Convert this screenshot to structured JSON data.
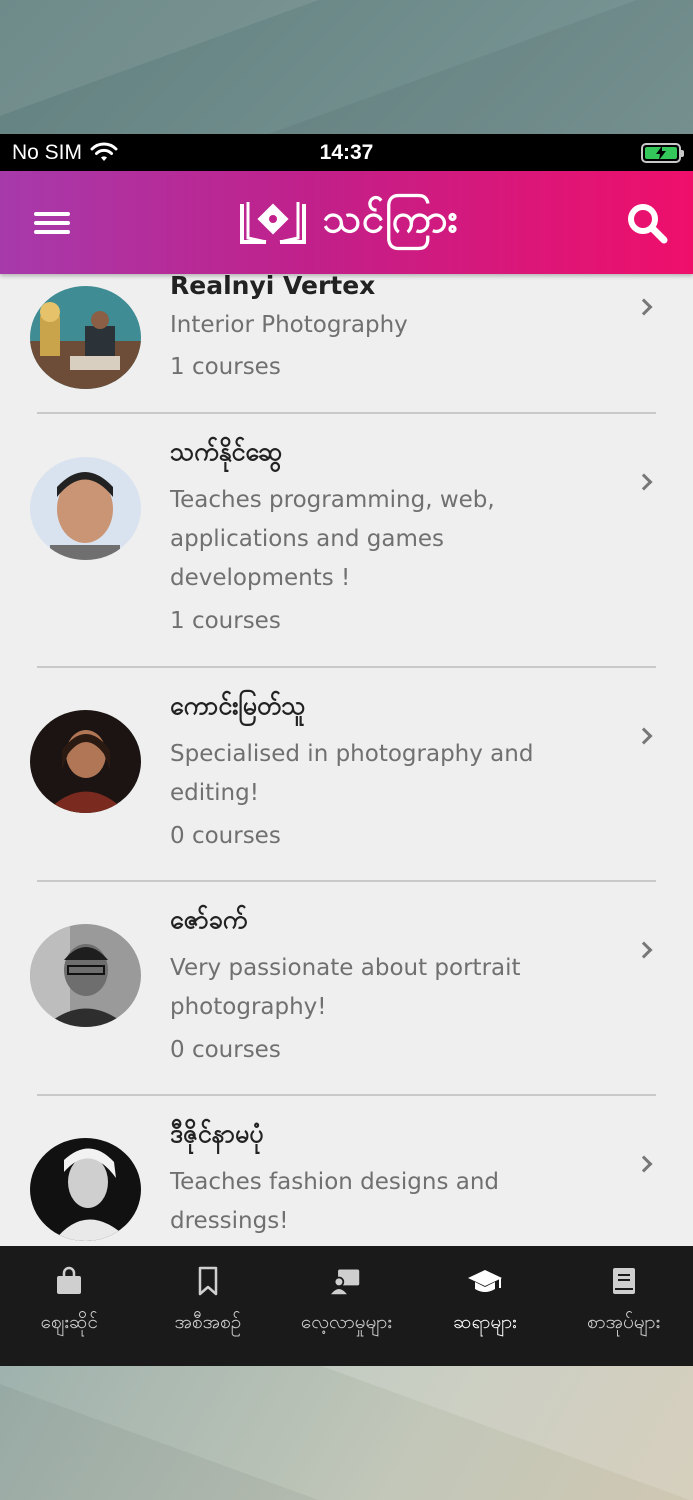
{
  "status": {
    "carrier": "No SIM",
    "time": "14:37"
  },
  "header": {
    "app_name": "သင်ကြား"
  },
  "teachers": [
    {
      "name": "Realnyi Vertex",
      "description": "Interior Photography",
      "courses": "1 courses"
    },
    {
      "name": "သက်နိုင်ဆွေ",
      "description": "Teaches programming, web, applications and games developments !",
      "courses": "1 courses"
    },
    {
      "name": "ကောင်းမြတ်သူ",
      "description": "Specialised in photography and editing!",
      "courses": "0 courses"
    },
    {
      "name": "ဇော်ခက်",
      "description": "Very passionate about portrait photography!",
      "courses": "0 courses"
    },
    {
      "name": "ဒီဇိုင်နာမပုံ",
      "description": "Teaches fashion designs and dressings!",
      "courses": ""
    }
  ],
  "tabs": [
    {
      "label": "ဈေးဆိုင်",
      "icon": "shopping-bag-icon"
    },
    {
      "label": "အစီအစဥ်",
      "icon": "bookmark-icon"
    },
    {
      "label": "လေ့လာမှုများ",
      "icon": "screen-user-icon"
    },
    {
      "label": "ဆရာများ",
      "icon": "graduation-cap-icon",
      "active": true
    },
    {
      "label": "စာအုပ်များ",
      "icon": "book-icon"
    }
  ],
  "colors": {
    "header_start": "#a73aab",
    "header_end": "#ef0f6b",
    "tabbar": "#1a1a1a"
  }
}
